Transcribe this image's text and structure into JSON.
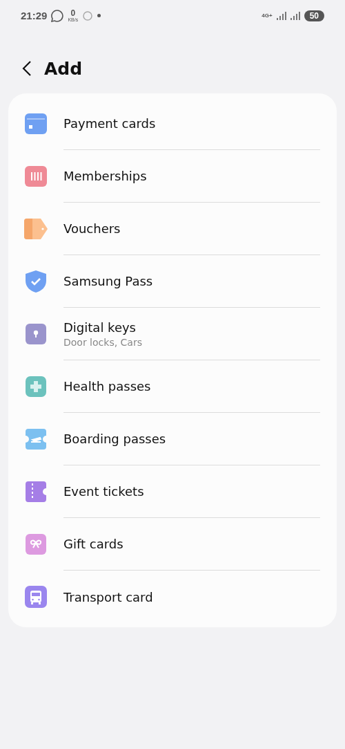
{
  "status_bar": {
    "time": "21:29",
    "speed_value": "0",
    "speed_unit": "KB/s",
    "network": "4G+",
    "battery": "50"
  },
  "header": {
    "title": "Add"
  },
  "items": [
    {
      "kind": "card",
      "label": "Payment cards",
      "color": "#6fa0f2"
    },
    {
      "kind": "membership",
      "label": "Memberships",
      "color": "#ef8a96"
    },
    {
      "kind": "voucher",
      "label": "Vouchers",
      "color": "#f5a66a"
    },
    {
      "kind": "shield",
      "label": "Samsung Pass",
      "color": "#6fa0f2"
    },
    {
      "kind": "key",
      "label": "Digital keys",
      "sublabel": "Door locks, Cars",
      "color": "#9a94cc"
    },
    {
      "kind": "health",
      "label": "Health passes",
      "color": "#6cc2bd"
    },
    {
      "kind": "boarding",
      "label": "Boarding passes",
      "color": "#7cc0f0"
    },
    {
      "kind": "ticket",
      "label": "Event tickets",
      "color": "#a57ee6"
    },
    {
      "kind": "gift",
      "label": "Gift cards",
      "color": "#dd9ae0"
    },
    {
      "kind": "transport",
      "label": "Transport card",
      "color": "#9a86ee"
    }
  ]
}
